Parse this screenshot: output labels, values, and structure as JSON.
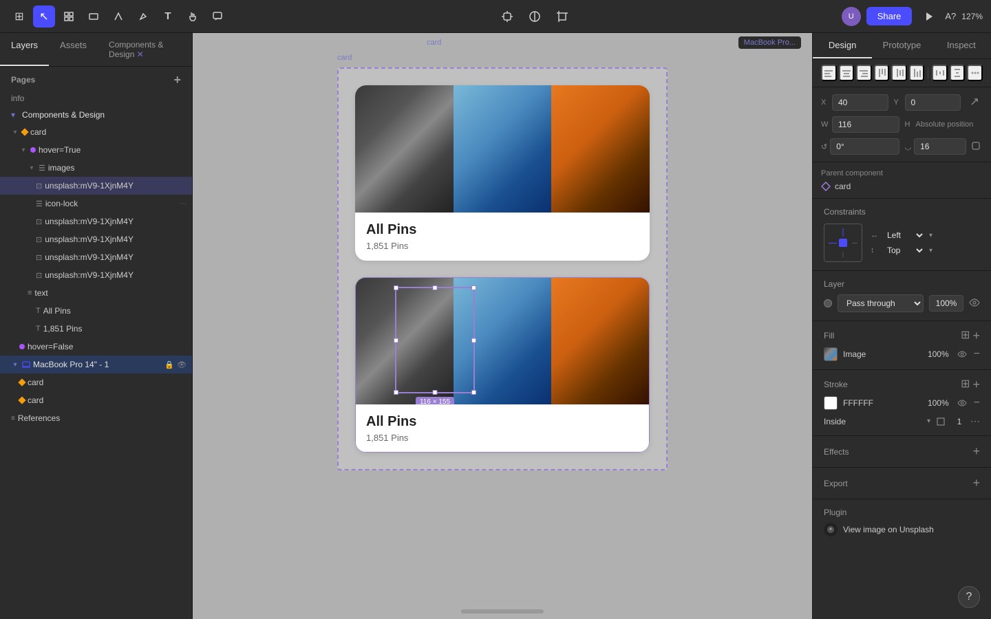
{
  "toolbar": {
    "tools": [
      {
        "name": "menu-tool",
        "icon": "⊞",
        "active": false
      },
      {
        "name": "select-tool",
        "icon": "↖",
        "active": true
      },
      {
        "name": "frame-tool",
        "icon": "▱",
        "active": false
      },
      {
        "name": "shape-tool",
        "icon": "○",
        "active": false
      },
      {
        "name": "pen-tool",
        "icon": "✒",
        "active": false
      },
      {
        "name": "text-tool",
        "icon": "T",
        "active": false
      },
      {
        "name": "hand-tool",
        "icon": "✋",
        "active": false
      },
      {
        "name": "comment-tool",
        "icon": "💬",
        "active": false
      }
    ],
    "center_tools": [
      {
        "name": "component-tool",
        "icon": "⊕"
      },
      {
        "name": "theme-tool",
        "icon": "◑"
      },
      {
        "name": "crop-tool",
        "icon": "⊡"
      }
    ],
    "share_label": "Share",
    "zoom_level": "127%"
  },
  "left_panel": {
    "tabs": [
      "Layers",
      "Assets",
      "Components & Design"
    ],
    "pages_title": "Pages",
    "pages": [
      {
        "name": "info"
      },
      {
        "name": "Components & Design",
        "expanded": true
      }
    ],
    "layers": [
      {
        "id": "card",
        "name": "card",
        "type": "diamond",
        "indent": 0,
        "expanded": true
      },
      {
        "id": "hover-true",
        "name": "hover=True",
        "type": "component",
        "indent": 1,
        "expanded": true
      },
      {
        "id": "images",
        "name": "images",
        "type": "frame-list",
        "indent": 2,
        "expanded": true
      },
      {
        "id": "unsplash1",
        "name": "unsplash:mV9-1XjnM4Y",
        "type": "image",
        "indent": 3,
        "selected": true,
        "highlighted": true
      },
      {
        "id": "icon-lock",
        "name": "icon-lock",
        "type": "frame-list",
        "indent": 3
      },
      {
        "id": "unsplash2",
        "name": "unsplash:mV9-1XjnM4Y",
        "type": "image",
        "indent": 3
      },
      {
        "id": "unsplash3",
        "name": "unsplash:mV9-1XjnM4Y",
        "type": "image",
        "indent": 3
      },
      {
        "id": "unsplash4",
        "name": "unsplash:mV9-1XjnM4Y",
        "type": "image",
        "indent": 3
      },
      {
        "id": "unsplash5",
        "name": "unsplash:mV9-1XjnM4Y",
        "type": "image",
        "indent": 3
      },
      {
        "id": "text-group",
        "name": "text",
        "type": "frame-list",
        "indent": 2
      },
      {
        "id": "all-pins",
        "name": "All Pins",
        "type": "text",
        "indent": 3
      },
      {
        "id": "1851-pins",
        "name": "1,851 Pins",
        "type": "text",
        "indent": 3
      },
      {
        "id": "hover-false",
        "name": "hover=False",
        "type": "component",
        "indent": 1
      },
      {
        "id": "macbook-pro",
        "name": "MacBook Pro 14\" - 1",
        "type": "frame",
        "indent": 0,
        "special": true
      },
      {
        "id": "card1",
        "name": "card",
        "type": "diamond",
        "indent": 1
      },
      {
        "id": "card2",
        "name": "card",
        "type": "diamond",
        "indent": 1
      },
      {
        "id": "references",
        "name": "References",
        "type": "list",
        "indent": 0
      }
    ]
  },
  "canvas": {
    "label": "card",
    "breadcrumb": "MacBook Pro...",
    "card_upper": {
      "title": "All Pins",
      "subtitle": "1,851 Pins"
    },
    "card_lower": {
      "title": "All Pins",
      "subtitle": "1,851 Pins",
      "selection_size": "116 × 155"
    }
  },
  "right_panel": {
    "tabs": [
      "Design",
      "Prototype",
      "Inspect"
    ],
    "active_tab": "Design",
    "position": {
      "x_label": "X",
      "x_value": "40",
      "y_label": "Y",
      "y_value": "0",
      "w_label": "W",
      "w_value": "116",
      "h_label": "H",
      "h_value": "Absolute position",
      "r_label": "°",
      "r_value": "0°",
      "corner_label": "",
      "corner_value": "16"
    },
    "parent_component": {
      "title": "Parent component",
      "name": "card"
    },
    "constraints": {
      "title": "Constraints",
      "left_label": "Left",
      "top_label": "Top"
    },
    "layer": {
      "title": "Layer",
      "blend_mode": "Pass through",
      "opacity": "100%"
    },
    "fill": {
      "title": "Fill",
      "type": "Image",
      "opacity": "100%"
    },
    "stroke": {
      "title": "Stroke",
      "color": "FFFFFF",
      "opacity": "100%",
      "position": "Inside",
      "width": "1"
    },
    "effects": {
      "title": "Effects"
    },
    "export": {
      "title": "Export"
    },
    "plugin": {
      "title": "Plugin",
      "name": "View image on Unsplash"
    }
  }
}
